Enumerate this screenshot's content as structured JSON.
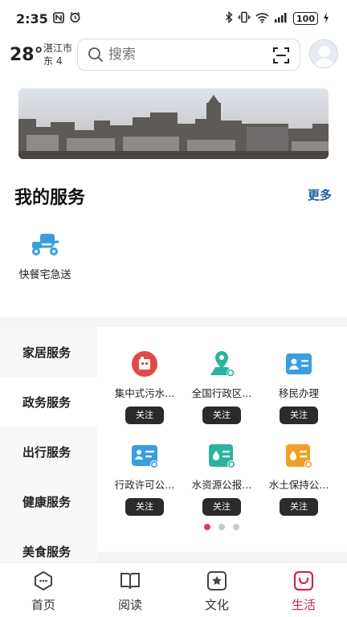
{
  "status_bar": {
    "time": "2:35",
    "battery": "100"
  },
  "header": {
    "temperature": "28°",
    "city": "湛江市",
    "wind": "东 4"
  },
  "search": {
    "placeholder": "搜索"
  },
  "my_services": {
    "title": "我的服务",
    "more": "更多",
    "items": [
      {
        "label": "快餐宅急送",
        "icon": "scooter-icon"
      }
    ]
  },
  "categories": [
    {
      "label": "家居服务"
    },
    {
      "label": "政务服务"
    },
    {
      "label": "出行服务"
    },
    {
      "label": "健康服务"
    },
    {
      "label": "美食服务"
    }
  ],
  "services": [
    {
      "label": "集中式污水...",
      "icon": "sewage-icon",
      "color": "#e24a4a",
      "follow": "关注"
    },
    {
      "label": "全国行政区...",
      "icon": "map-pin-icon",
      "color": "#2bb3a0",
      "follow": "关注"
    },
    {
      "label": "移民办理",
      "icon": "id-card-icon",
      "color": "#3a9fe0",
      "follow": "关注"
    },
    {
      "label": "行政许可公...",
      "icon": "license-icon",
      "color": "#3a9fe0",
      "follow": "关注"
    },
    {
      "label": "水资源公报...",
      "icon": "water-report-icon",
      "color": "#2bb3a0",
      "follow": "关注"
    },
    {
      "label": "水土保持公...",
      "icon": "soil-report-icon",
      "color": "#f0a028",
      "follow": "关注"
    }
  ],
  "pagination": {
    "pages": 3,
    "current": 1
  },
  "bottom_nav": [
    {
      "label": "首页",
      "icon": "home-icon"
    },
    {
      "label": "阅读",
      "icon": "book-icon"
    },
    {
      "label": "文化",
      "icon": "culture-icon"
    },
    {
      "label": "生活",
      "icon": "life-icon",
      "active": true
    }
  ],
  "colors": {
    "accent": "#c8294f",
    "more_link": "#1f5fa8",
    "follow_button": "#2b2b2b"
  }
}
